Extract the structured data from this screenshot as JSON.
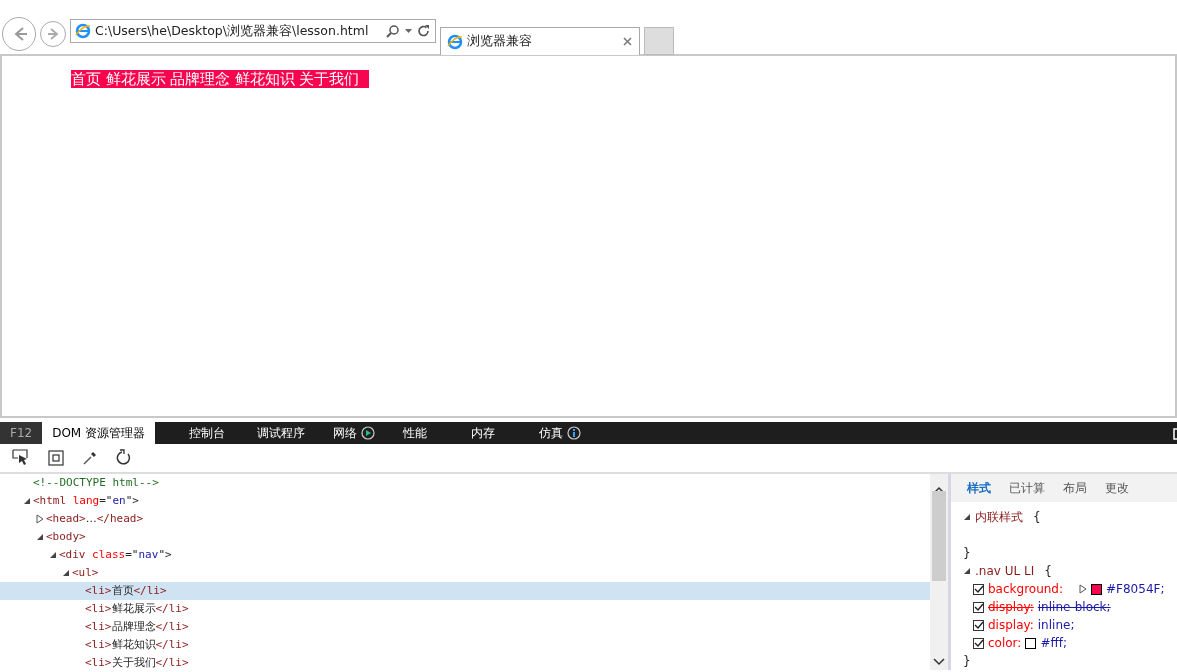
{
  "browser": {
    "address": "C:\\Users\\he\\Desktop\\浏览器兼容\\lesson.html",
    "tabs": [
      {
        "title": "浏览器兼容",
        "selected": true
      }
    ]
  },
  "page": {
    "nav_items": [
      "首页",
      "鲜花展示",
      "品牌理念",
      "鲜花知识",
      "关于我们"
    ]
  },
  "devtools": {
    "f12_label": "F12",
    "tabs": [
      {
        "label": "DOM 资源管理器",
        "selected": true,
        "kind": "plain"
      },
      {
        "label": "控制台",
        "selected": false,
        "kind": "plain"
      },
      {
        "label": "调试程序",
        "selected": false,
        "kind": "plain"
      },
      {
        "label": "网络",
        "selected": false,
        "kind": "status"
      },
      {
        "label": "性能",
        "selected": false,
        "kind": "plain"
      },
      {
        "label": "内存",
        "selected": false,
        "kind": "plain"
      },
      {
        "label": "仿真",
        "selected": false,
        "kind": "info"
      }
    ],
    "dom_tree": [
      {
        "parts": [
          {
            "kind": "comment",
            "text": "<!--DOCTYPE html-->"
          }
        ],
        "selected": false
      },
      {
        "parts": [
          {
            "kind": "tag",
            "text": "<html"
          },
          {
            "kind": "attr",
            "text": " lang"
          },
          {
            "kind": "punct",
            "text": "=\""
          },
          {
            "kind": "value",
            "text": "en"
          },
          {
            "kind": "punct",
            "text": "\">"
          }
        ],
        "selected": false,
        "expanded": true,
        "children": [
          {
            "parts": [
              {
                "kind": "tag",
                "text": "<head>"
              },
              {
                "kind": "text",
                "text": "…"
              },
              {
                "kind": "tag",
                "text": "</head>"
              }
            ],
            "selected": false,
            "expanded": false
          },
          {
            "parts": [
              {
                "kind": "tag",
                "text": "<body>"
              }
            ],
            "selected": false,
            "expanded": true,
            "children": [
              {
                "parts": [
                  {
                    "kind": "tag",
                    "text": "<div"
                  },
                  {
                    "kind": "attr",
                    "text": " class"
                  },
                  {
                    "kind": "punct",
                    "text": "=\""
                  },
                  {
                    "kind": "value",
                    "text": "nav"
                  },
                  {
                    "kind": "punct",
                    "text": "\">"
                  }
                ],
                "selected": false,
                "expanded": true,
                "children": [
                  {
                    "parts": [
                      {
                        "kind": "tag",
                        "text": "<ul>"
                      }
                    ],
                    "selected": false,
                    "expanded": true,
                    "children": [
                      {
                        "parts": [
                          {
                            "kind": "tag",
                            "text": "<li>"
                          },
                          {
                            "kind": "text",
                            "text": "首页"
                          },
                          {
                            "kind": "tag",
                            "text": "</li>"
                          }
                        ],
                        "selected": true
                      },
                      {
                        "parts": [
                          {
                            "kind": "tag",
                            "text": "<li>"
                          },
                          {
                            "kind": "text",
                            "text": "鲜花展示"
                          },
                          {
                            "kind": "tag",
                            "text": "</li>"
                          }
                        ],
                        "selected": false
                      },
                      {
                        "parts": [
                          {
                            "kind": "tag",
                            "text": "<li>"
                          },
                          {
                            "kind": "text",
                            "text": "品牌理念"
                          },
                          {
                            "kind": "tag",
                            "text": "</li>"
                          }
                        ],
                        "selected": false
                      },
                      {
                        "parts": [
                          {
                            "kind": "tag",
                            "text": "<li>"
                          },
                          {
                            "kind": "text",
                            "text": "鲜花知识"
                          },
                          {
                            "kind": "tag",
                            "text": "</li>"
                          }
                        ],
                        "selected": false
                      },
                      {
                        "parts": [
                          {
                            "kind": "tag",
                            "text": "<li>"
                          },
                          {
                            "kind": "text",
                            "text": "关于我们"
                          },
                          {
                            "kind": "tag",
                            "text": "</li>"
                          }
                        ],
                        "selected": false
                      }
                    ]
                  }
                ]
              }
            ]
          }
        ]
      }
    ],
    "style_tabs": [
      {
        "label": "样式",
        "selected": true
      },
      {
        "label": "已计算",
        "selected": false
      },
      {
        "label": "布局",
        "selected": false
      },
      {
        "label": "更改",
        "selected": false
      }
    ],
    "rules": [
      {
        "selector": "内联样式",
        "open": "{",
        "close": "}"
      },
      {
        "selector": ".nav UL LI",
        "open": "{",
        "close": "}",
        "properties": [
          {
            "name": "background:",
            "value": "#F8054F;",
            "checked": true,
            "overridden": false,
            "color": "#f8054f",
            "expandable": true
          },
          {
            "name": "display:",
            "value": "inline-block;",
            "checked": true,
            "overridden": true
          },
          {
            "name": "display:",
            "value": "inline;",
            "checked": true,
            "overridden": false
          },
          {
            "name": "color:",
            "value": "#fff;",
            "checked": true,
            "overridden": false,
            "color": "#ffffff"
          }
        ]
      }
    ]
  }
}
